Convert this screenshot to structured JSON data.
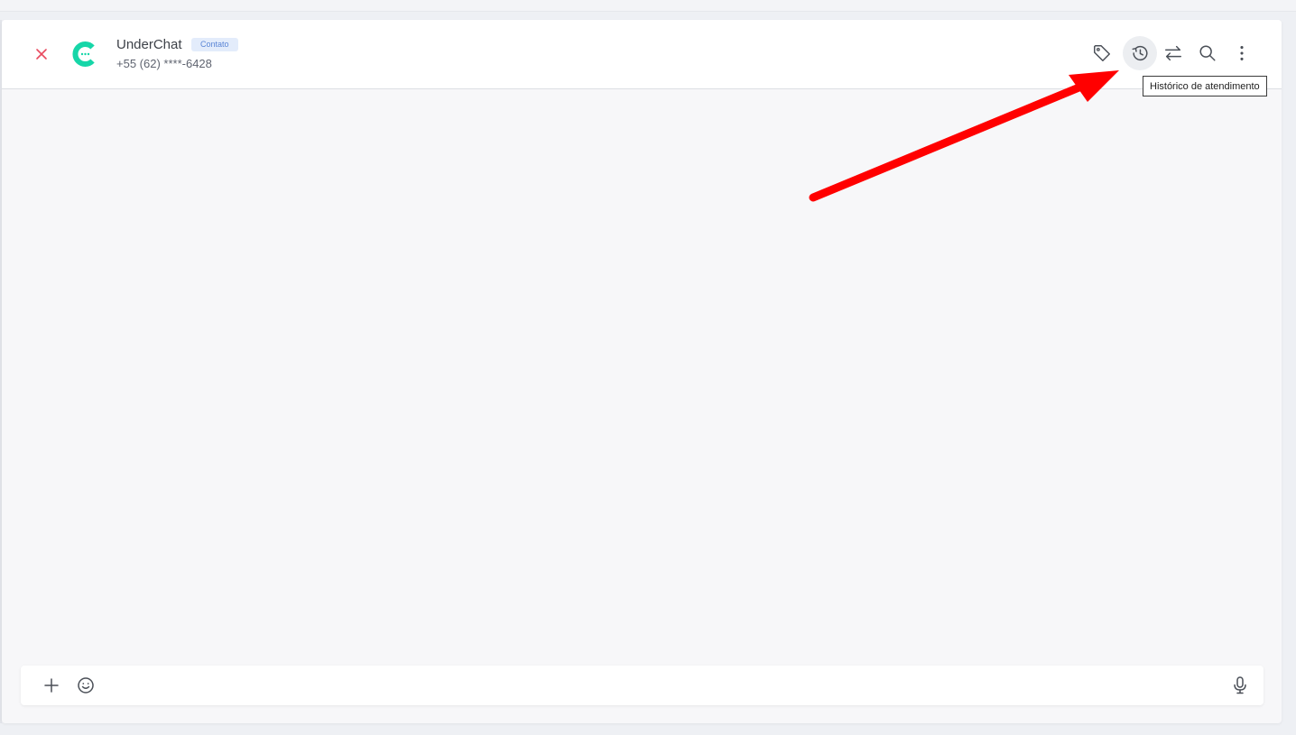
{
  "chat_header": {
    "contact_name": "UnderChat",
    "contact_badge": "Contato",
    "contact_phone": "+55 (62) ****-6428"
  },
  "header_actions": [
    {
      "icon": "tag-icon",
      "label": "Etiquetas"
    },
    {
      "icon": "history-icon",
      "label": "Histórico de atendimento",
      "state": "hovered"
    },
    {
      "icon": "transfer-icon",
      "label": "Transferir"
    },
    {
      "icon": "search-icon",
      "label": "Pesquisar"
    },
    {
      "icon": "more-vertical-icon",
      "label": "Mais opções"
    }
  ],
  "tooltip": {
    "text": "Histórico de atendimento"
  },
  "composer": {
    "message_value": "",
    "message_placeholder": ""
  },
  "colors": {
    "brand_green": "#16d6a8",
    "close_red": "#e84a5f",
    "annotation_arrow": "#ff0000",
    "badge_bg": "#e3ecfb",
    "badge_text": "#5b86d6"
  }
}
